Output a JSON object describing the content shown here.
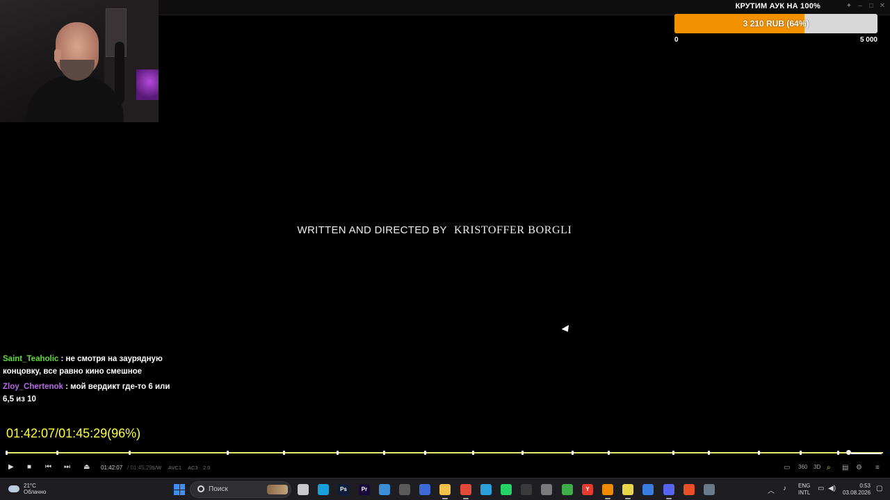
{
  "goal": {
    "title": "КРУТИМ АУК НА 100%",
    "current_text": "3 210 RUB (64%)",
    "progress_pct": 64,
    "min_label": "0",
    "max_label": "5 000",
    "fill_color": "#f39200"
  },
  "credits": {
    "prefix": "WRITTEN AND DIRECTED BY",
    "name": "KRISTOFFER BORGLI"
  },
  "chat": {
    "messages": [
      {
        "user": "Saint_Teaholic",
        "user_color": "#5fdc3a",
        "text": ": не смотря на заурядную концовку, все равно кино смешное"
      },
      {
        "user": "Zloy_Chertenok",
        "user_color": "#b86ae6",
        "text": ": мой вердикт где-то 6 или 6,5 из 10"
      }
    ]
  },
  "timer": {
    "text": "01:42:07/01:45:29(96%)"
  },
  "player": {
    "time_current": "01:42:07",
    "time_total": "/ 01:45:29",
    "formats": [
      "S/W",
      "AVC1",
      "AC3",
      "2.0"
    ],
    "progress_pct": 96,
    "volume_pct": 100,
    "icons": {
      "play": "play-icon",
      "stop": "stop-icon",
      "prev": "prev-icon",
      "next": "next-icon",
      "eject": "eject-icon"
    }
  },
  "taskbar": {
    "weather_temp": "21°C",
    "weather_desc": "Облачно",
    "search_placeholder": "Поиск",
    "lang_top": "ENG",
    "lang_bottom": "INTL",
    "time": "0:53",
    "date": "03.08.2026",
    "apps": [
      {
        "name": "file-explorer-icon",
        "color": "#c9c9c9",
        "glyph": ""
      },
      {
        "name": "edge-icon",
        "color": "#1aa0d8",
        "glyph": ""
      },
      {
        "name": "photoshop-icon",
        "color": "#0c1e3a",
        "glyph": "Ps"
      },
      {
        "name": "premiere-icon",
        "color": "#1a0a3a",
        "glyph": "Pr"
      },
      {
        "name": "app-blue-icon",
        "color": "#3c8fd6",
        "glyph": ""
      },
      {
        "name": "calculator-icon",
        "color": "#5a5a5a",
        "glyph": ""
      },
      {
        "name": "snipping-icon",
        "color": "#3e6ad6",
        "glyph": ""
      },
      {
        "name": "folder-icon",
        "color": "#f0c14b",
        "glyph": ""
      },
      {
        "name": "chrome-icon",
        "color": "#e04a3a",
        "glyph": ""
      },
      {
        "name": "telegram-icon",
        "color": "#2aa1da",
        "glyph": ""
      },
      {
        "name": "whatsapp-icon",
        "color": "#25d366",
        "glyph": ""
      },
      {
        "name": "obs-icon",
        "color": "#3a3a3a",
        "glyph": ""
      },
      {
        "name": "app-shield-icon",
        "color": "#7a7a7a",
        "glyph": ""
      },
      {
        "name": "app-green-icon",
        "color": "#3fae4a",
        "glyph": ""
      },
      {
        "name": "yandex-browser-icon",
        "color": "#e33b2e",
        "glyph": "Y"
      },
      {
        "name": "vlc-icon",
        "color": "#f08a00",
        "glyph": ""
      },
      {
        "name": "sticky-notes-icon",
        "color": "#e8d64a",
        "glyph": ""
      },
      {
        "name": "app-grid-icon",
        "color": "#3a7ce0",
        "glyph": ""
      },
      {
        "name": "discord-icon",
        "color": "#5865f2",
        "glyph": ""
      },
      {
        "name": "app-orange-icon",
        "color": "#e8502a",
        "glyph": ""
      },
      {
        "name": "settings-icon",
        "color": "#6a7a8a",
        "glyph": ""
      }
    ]
  }
}
